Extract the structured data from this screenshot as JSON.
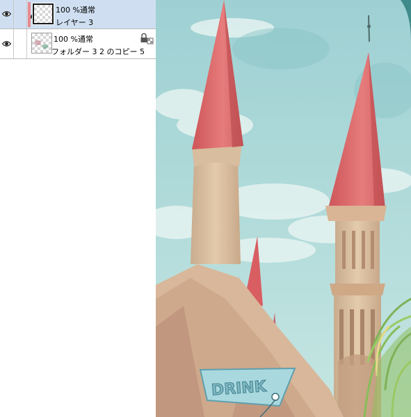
{
  "layers": [
    {
      "opacity_blend": "100 %通常",
      "name": "レイヤー 3",
      "selected": true,
      "visible": true,
      "color_tag": "#e98a90",
      "icons": [
        "eye-icon",
        "brush-icon"
      ]
    },
    {
      "opacity_blend": "100 %通常",
      "name": "フォルダー 3 2 のコピー 5",
      "selected": false,
      "visible": true,
      "icons": [
        "eye-icon",
        "lock-icon"
      ]
    }
  ],
  "canvas": {
    "sign_text": "DRINK"
  },
  "colors": {
    "selected_row": "#cfdff1",
    "sky": "#a9d6d6",
    "roof": "#e0686a",
    "tower": "#dcc3a4"
  }
}
